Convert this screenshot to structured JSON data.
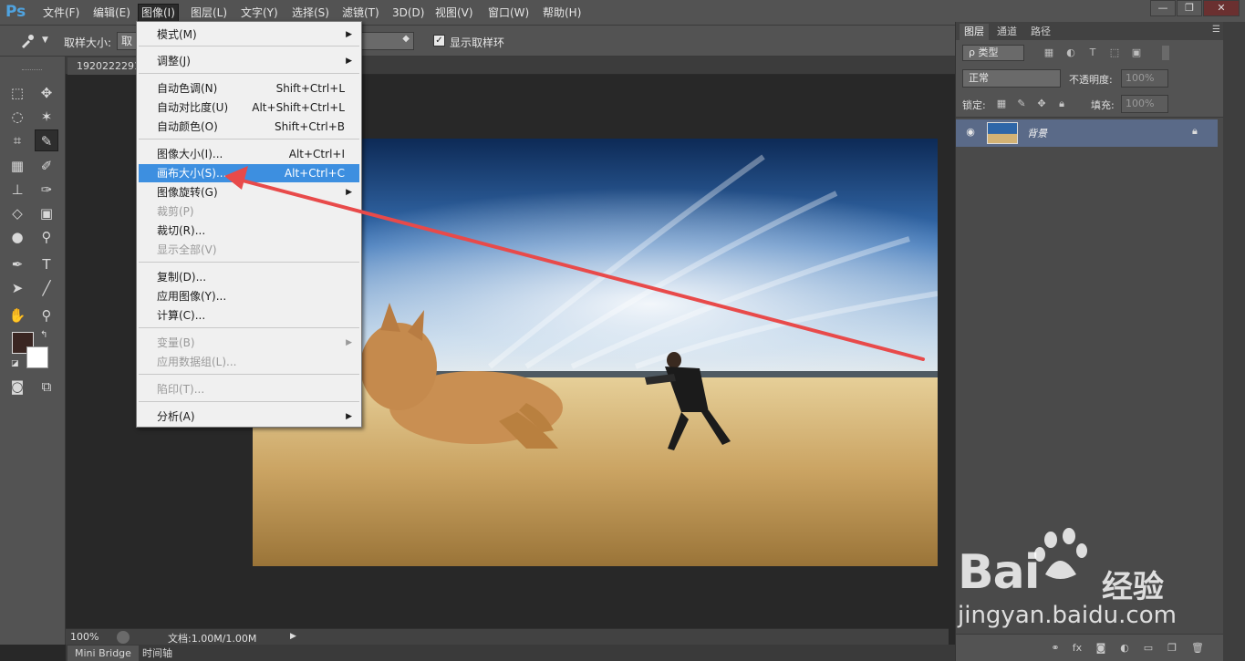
{
  "app": {
    "logo": "Ps"
  },
  "menubar": {
    "items": [
      {
        "label": "文件(F)"
      },
      {
        "label": "编辑(E)"
      },
      {
        "label": "图像(I)"
      },
      {
        "label": "图层(L)"
      },
      {
        "label": "文字(Y)"
      },
      {
        "label": "选择(S)"
      },
      {
        "label": "滤镜(T)"
      },
      {
        "label": "3D(D)"
      },
      {
        "label": "视图(V)"
      },
      {
        "label": "窗口(W)"
      },
      {
        "label": "帮助(H)"
      }
    ],
    "window_buttons": [
      "—",
      "❐",
      "✕"
    ]
  },
  "options": {
    "sample_size_label": "取样大小:",
    "sample_size_value": "取",
    "show_ring_label": "显示取样环",
    "show_ring_checked": true
  },
  "document": {
    "tab_title": "1920222291"
  },
  "image_menu": {
    "items": [
      {
        "label": "模式(M)",
        "shortcut": "",
        "submenu": true,
        "disabled": false,
        "highlight": false
      },
      {
        "label": "调整(J)",
        "shortcut": "",
        "submenu": true,
        "disabled": false,
        "highlight": false
      },
      {
        "label": "自动色调(N)",
        "shortcut": "Shift+Ctrl+L",
        "submenu": false,
        "disabled": false,
        "highlight": false
      },
      {
        "label": "自动对比度(U)",
        "shortcut": "Alt+Shift+Ctrl+L",
        "submenu": false,
        "disabled": false,
        "highlight": false
      },
      {
        "label": "自动颜色(O)",
        "shortcut": "Shift+Ctrl+B",
        "submenu": false,
        "disabled": false,
        "highlight": false
      },
      {
        "label": "图像大小(I)...",
        "shortcut": "Alt+Ctrl+I",
        "submenu": false,
        "disabled": false,
        "highlight": false
      },
      {
        "label": "画布大小(S)...",
        "shortcut": "Alt+Ctrl+C",
        "submenu": false,
        "disabled": false,
        "highlight": true
      },
      {
        "label": "图像旋转(G)",
        "shortcut": "",
        "submenu": true,
        "disabled": false,
        "highlight": false
      },
      {
        "label": "裁剪(P)",
        "shortcut": "",
        "submenu": false,
        "disabled": true,
        "highlight": false
      },
      {
        "label": "裁切(R)...",
        "shortcut": "",
        "submenu": false,
        "disabled": false,
        "highlight": false
      },
      {
        "label": "显示全部(V)",
        "shortcut": "",
        "submenu": false,
        "disabled": true,
        "highlight": false
      },
      {
        "label": "复制(D)...",
        "shortcut": "",
        "submenu": false,
        "disabled": false,
        "highlight": false
      },
      {
        "label": "应用图像(Y)...",
        "shortcut": "",
        "submenu": false,
        "disabled": false,
        "highlight": false
      },
      {
        "label": "计算(C)...",
        "shortcut": "",
        "submenu": false,
        "disabled": false,
        "highlight": false
      },
      {
        "label": "变量(B)",
        "shortcut": "",
        "submenu": true,
        "disabled": true,
        "highlight": false
      },
      {
        "label": "应用数据组(L)...",
        "shortcut": "",
        "submenu": false,
        "disabled": true,
        "highlight": false
      },
      {
        "label": "陷印(T)...",
        "shortcut": "",
        "submenu": false,
        "disabled": true,
        "highlight": false
      },
      {
        "label": "分析(A)",
        "shortcut": "",
        "submenu": true,
        "disabled": false,
        "highlight": false
      }
    ]
  },
  "status": {
    "zoom": "100%",
    "doc_info": "文档:1.00M/1.00M"
  },
  "bottom_tabs": [
    {
      "label": "Mini Bridge"
    },
    {
      "label": "时间轴"
    }
  ],
  "layers_panel": {
    "tabs": [
      {
        "label": "图层"
      },
      {
        "label": "通道"
      },
      {
        "label": "路径"
      }
    ],
    "kind_filter": "ρ 类型",
    "blend_mode": "正常",
    "opacity_label": "不透明度:",
    "opacity_value": "100%",
    "lock_label": "锁定:",
    "fill_label": "填充:",
    "fill_value": "100%",
    "layers": [
      {
        "name": "背景",
        "locked": true,
        "visible": true
      }
    ]
  },
  "watermark": {
    "brand": "Bai",
    "brand_cn": "经验",
    "url": "jingyan.baidu.com"
  },
  "colors": {
    "highlight": "#3d8fe0",
    "arrow": "#e84a4a",
    "foreground": "#3a2622",
    "background": "#ffffff"
  }
}
